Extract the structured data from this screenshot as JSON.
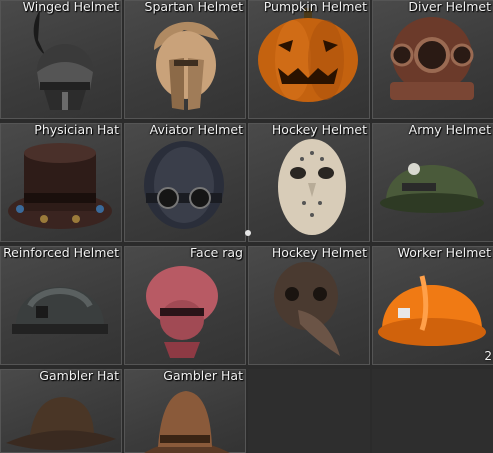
{
  "inventory": {
    "slots": [
      {
        "label": "Winged Helmet",
        "icon": "winged-helmet-icon"
      },
      {
        "label": "Spartan Helmet",
        "icon": "spartan-helmet-icon"
      },
      {
        "label": "Pumpkin Helmet",
        "icon": "pumpkin-helmet-icon"
      },
      {
        "label": "Diver Helmet",
        "icon": "diver-helmet-icon"
      },
      {
        "label": "Physician Hat",
        "icon": "physician-hat-icon"
      },
      {
        "label": "Aviator Helmet",
        "icon": "aviator-helmet-icon"
      },
      {
        "label": "Hockey Helmet",
        "icon": "hockey-mask-icon"
      },
      {
        "label": "Army Helmet",
        "icon": "army-helmet-icon"
      },
      {
        "label": "Reinforced Helmet",
        "icon": "reinforced-helmet-icon"
      },
      {
        "label": "Face rag",
        "icon": "face-rag-icon"
      },
      {
        "label": "Hockey Helmet",
        "icon": "plague-mask-icon"
      },
      {
        "label": "Worker  Helmet",
        "icon": "worker-helmet-icon",
        "count": "2"
      },
      {
        "label": "Gambler Hat",
        "icon": "gambler-hat-icon"
      },
      {
        "label": "Gambler Hat",
        "icon": "gambler-hat-tall-icon"
      }
    ]
  }
}
